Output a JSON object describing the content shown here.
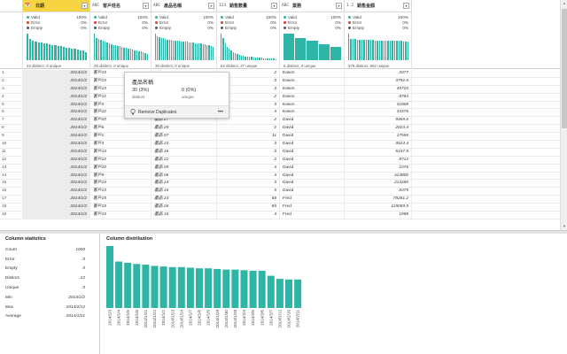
{
  "columns": [
    {
      "name": "日期",
      "type_icon": "📅",
      "type_label": "date-type-icon",
      "selected": true,
      "width": 76
    },
    {
      "name": "客戶姓名",
      "type_icon": "ABC",
      "type_label": "text-type-icon",
      "selected": false,
      "width": 69
    },
    {
      "name": "產品名稱",
      "type_icon": "ABC",
      "type_label": "text-type-icon",
      "selected": false,
      "width": 74
    },
    {
      "name": "銷售數量",
      "type_icon": "123",
      "type_label": "number-type-icon",
      "selected": false,
      "width": 71
    },
    {
      "name": "業務",
      "type_icon": "ABC",
      "type_label": "text-type-icon",
      "selected": false,
      "width": 73
    },
    {
      "name": "銷售金額",
      "type_icon": "1.2",
      "type_label": "decimal-type-icon",
      "selected": false,
      "width": 76
    }
  ],
  "quality": [
    {
      "valid": "100%",
      "error": "0%",
      "empty": "0%",
      "distinct": "22 distinct, 0 unique"
    },
    {
      "valid": "100%",
      "error": "0%",
      "empty": "0%",
      "distinct": "26 distinct, 0 unique"
    },
    {
      "valid": "100%",
      "error": "0%",
      "empty": "0%",
      "distinct": "30 distinct, 0 unique"
    },
    {
      "valid": "100%",
      "error": "0%",
      "empty": "0%",
      "distinct": "62 distinct, 27 unique"
    },
    {
      "valid": "100%",
      "error": "0%",
      "empty": "0%",
      "distinct": "5 distinct, 0 unique"
    },
    {
      "valid": "100%",
      "error": "0%",
      "empty": "0%",
      "distinct": "679 distinct, 652 unique"
    }
  ],
  "quality_labels": {
    "valid": "Valid",
    "error": "Error",
    "empty": "Empty"
  },
  "quality_bar_levels": [
    [
      1.0,
      0.8,
      0.72,
      0.7,
      0.68,
      0.66,
      0.64,
      0.62,
      0.6,
      0.58,
      0.56,
      0.54,
      0.52,
      0.5,
      0.48,
      0.46,
      0.44,
      0.42,
      0.4,
      0.38,
      0.36,
      0.3
    ],
    [
      1.0,
      0.85,
      0.8,
      0.76,
      0.72,
      0.7,
      0.66,
      0.64,
      0.6,
      0.58,
      0.56,
      0.54,
      0.52,
      0.5,
      0.48,
      0.46,
      0.44,
      0.42,
      0.4,
      0.38,
      0.36,
      0.34,
      0.32,
      0.3,
      0.28,
      0.22
    ],
    [
      1.0,
      0.9,
      0.86,
      0.84,
      0.82,
      0.8,
      0.78,
      0.77,
      0.76,
      0.75,
      0.74,
      0.73,
      0.72,
      0.71,
      0.7,
      0.7,
      0.69,
      0.68,
      0.67,
      0.66,
      0.65,
      0.64,
      0.63,
      0.62,
      0.61,
      0.6,
      0.58,
      0.56,
      0.54,
      0.5
    ],
    [
      1.0,
      0.82,
      0.62,
      0.5,
      0.42,
      0.36,
      0.3,
      0.26,
      0.22,
      0.2,
      0.18,
      0.16,
      0.15,
      0.14,
      0.13,
      0.12,
      0.11,
      0.1,
      0.1,
      0.09,
      0.09,
      0.08,
      0.08,
      0.07,
      0.07,
      0.06,
      0.06,
      0.05
    ],
    [
      1.0,
      0.85,
      0.72,
      0.6,
      0.5
    ],
    [
      1.0,
      0.8,
      0.8,
      0.8,
      0.78,
      0.78,
      0.78,
      0.77,
      0.77,
      0.76,
      0.76,
      0.76,
      0.75,
      0.75,
      0.75,
      0.74,
      0.74,
      0.74,
      0.74,
      0.73,
      0.73,
      0.73,
      0.72,
      0.72,
      0.72,
      0.71,
      0.71,
      0.7
    ]
  ],
  "rows": [
    {
      "n": "1",
      "date": "2014/1/2",
      "cust": "客戶15",
      "prod": "",
      "qty": "2",
      "rep": "Eason",
      "amt": "2077"
    },
    {
      "n": "2",
      "date": "2014/1/2",
      "cust": "客戶24",
      "prod": "",
      "qty": "3",
      "rep": "Eason",
      "amt": "3792.6"
    },
    {
      "n": "3",
      "date": "2014/1/2",
      "cust": "客戶13",
      "prod": "",
      "qty": "3",
      "rep": "Eason",
      "amt": "45720"
    },
    {
      "n": "4",
      "date": "2014/1/2",
      "cust": "客戶12",
      "prod": "",
      "qty": "2",
      "rep": "Eason",
      "amt": "8784"
    },
    {
      "n": "5",
      "date": "2014/1/2",
      "cust": "客戶3",
      "prod": "",
      "qty": "3",
      "rep": "Eason",
      "amt": "31808"
    },
    {
      "n": "6",
      "date": "2014/1/2",
      "cust": "客戶22",
      "prod": "",
      "qty": "4",
      "rep": "Eason",
      "amt": "33376"
    },
    {
      "n": "7",
      "date": "2014/1/2",
      "cust": "客戶20",
      "prod": "產品 27",
      "qty": "2",
      "rep": "David",
      "amt": "9469.6"
    },
    {
      "n": "8",
      "date": "2014/1/2",
      "cust": "客戶6",
      "prod": "產品 25",
      "qty": "2",
      "rep": "David",
      "amt": "2023.4"
    },
    {
      "n": "9",
      "date": "2014/1/2",
      "cust": "客戶1",
      "prod": "產品 07",
      "qty": "11",
      "rep": "David",
      "amt": "17556"
    },
    {
      "n": "10",
      "date": "2014/1/2",
      "cust": "客戶3",
      "prod": "產品 23",
      "qty": "3",
      "rep": "David",
      "amt": "3524.4"
    },
    {
      "n": "11",
      "date": "2014/1/2",
      "cust": "客戶14",
      "prod": "產品 16",
      "qty": "3",
      "rep": "David",
      "amt": "5157.5"
    },
    {
      "n": "12",
      "date": "2014/1/2",
      "cust": "客戶12",
      "prod": "產品 22",
      "qty": "2",
      "rep": "David",
      "amt": "8712"
    },
    {
      "n": "13",
      "date": "2014/1/2",
      "cust": "客戶20",
      "prod": "產品 09",
      "qty": "4",
      "rep": "David",
      "amt": "2376"
    },
    {
      "n": "14",
      "date": "2014/1/2",
      "cust": "客戶9",
      "prod": "產品 06",
      "qty": "4",
      "rep": "David",
      "amt": "424800"
    },
    {
      "n": "15",
      "date": "2014/1/2",
      "cust": "客戶24",
      "prod": "產品 24",
      "qty": "3",
      "rep": "David",
      "amt": "213280"
    },
    {
      "n": "16",
      "date": "2014/1/2",
      "cust": "客戶13",
      "prod": "產品 16",
      "qty": "5",
      "rep": "David",
      "amt": "8375"
    },
    {
      "n": "17",
      "date": "2014/1/2",
      "cust": "客戶15",
      "prod": "產品 23",
      "qty": "68",
      "rep": "Fred",
      "amt": "79281.2"
    },
    {
      "n": "18",
      "date": "2014/1/2",
      "cust": "客戶15",
      "prod": "產品 26",
      "qty": "85",
      "rep": "Fred",
      "amt": "119059.5"
    },
    {
      "n": "19",
      "date": "2014/1/2",
      "cust": "客戶15",
      "prod": "產品 15",
      "qty": "4",
      "rep": "Fred",
      "amt": "1998"
    }
  ],
  "tooltip": {
    "title": "產品名稱",
    "distinct_value": "30 (3%)",
    "distinct_label": "distinct",
    "unique_value": "0 (0%)",
    "unique_label": "unique",
    "action": "Remove Duplicates",
    "more": "•••"
  },
  "stats": {
    "title": "Column statistics",
    "items": [
      {
        "key": "Count",
        "value": "1000"
      },
      {
        "key": "Error",
        "value": "0"
      },
      {
        "key": "Empty",
        "value": "0"
      },
      {
        "key": "Distinct",
        "value": "22"
      },
      {
        "key": "Unique",
        "value": "0"
      },
      {
        "key": "Min",
        "value": "2014/1/2"
      },
      {
        "key": "Max",
        "value": "2014/2/12"
      },
      {
        "key": "Average",
        "value": "2014/1/21"
      }
    ]
  },
  "distribution": {
    "title": "Column distribution",
    "color": "#2fb5a6"
  },
  "chart_data": {
    "type": "bar",
    "title": "",
    "xlabel": "",
    "ylabel": "",
    "categories": [
      "2014/1/3",
      "2014/1/4",
      "2014/1/5",
      "2014/1/6",
      "2014/1/21",
      "2014/1/22",
      "2014/1/2",
      "2014/1/23",
      "2014/1/24",
      "2014/1/7",
      "2014/1/8",
      "2014/1/9",
      "2014/1/29",
      "2014/1/30",
      "2014/1/28",
      "2014/2/4",
      "2014/2/5",
      "2014/2/6",
      "2014/2/7",
      "2014/2/12",
      "2014/2/10",
      "2014/2/11"
    ],
    "values": [
      100,
      75,
      73,
      71,
      70,
      68,
      67,
      66,
      66,
      65,
      64,
      64,
      63,
      62,
      62,
      61,
      60,
      60,
      52,
      47,
      46,
      46
    ],
    "ylim": [
      0,
      100
    ],
    "grid": false
  }
}
